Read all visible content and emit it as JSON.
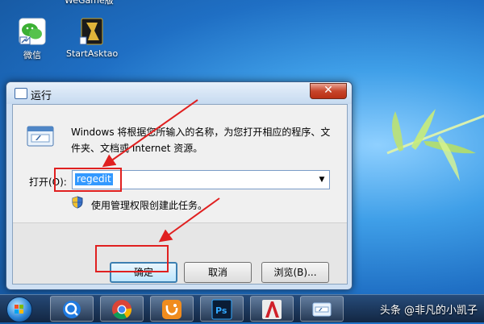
{
  "desktop": {
    "top_cut_label": "WeGame版",
    "icons": [
      {
        "label": "微信",
        "icon": "wechat-icon"
      },
      {
        "label": "StartAsktao",
        "icon": "asktao-game-icon"
      }
    ]
  },
  "run_dialog": {
    "title": "运行",
    "close_label": "✕",
    "description": "Windows 将根据您所输入的名称，为您打开相应的程序、文件夹、文档或 Internet 资源。",
    "open_label": "打开(O):",
    "open_value": "regedit",
    "admin_note": "使用管理权限创建此任务。",
    "buttons": {
      "ok": "确定",
      "cancel": "取消",
      "browse": "浏览(B)..."
    }
  },
  "taskbar": {
    "apps": [
      "search-app-icon",
      "chrome-icon",
      "uc-browser-icon",
      "photoshop-icon",
      "autocad-icon",
      "run-window-icon"
    ]
  },
  "watermark": "头条 @非凡的小凯子",
  "colors": {
    "annotation_red": "#e02020",
    "dialog_frame": "#cfe0f3"
  }
}
